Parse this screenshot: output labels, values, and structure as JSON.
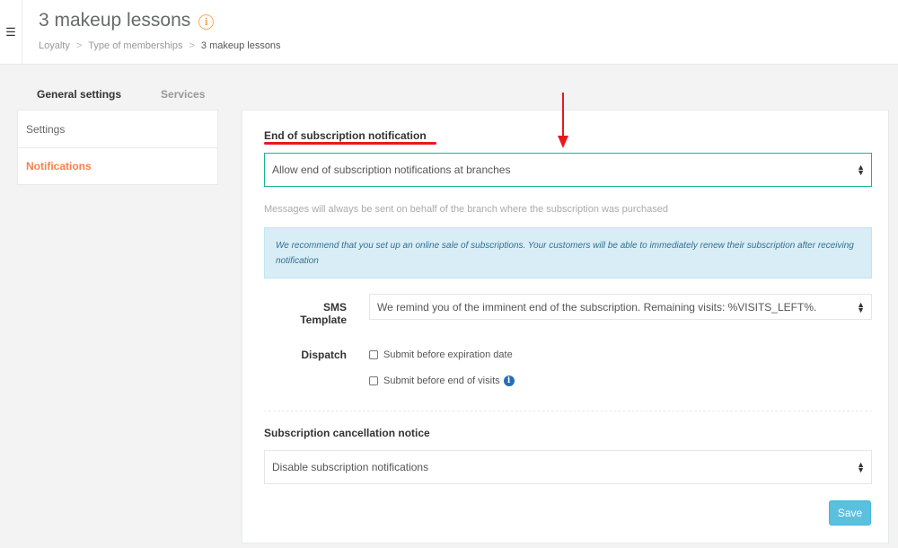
{
  "header": {
    "title": "3 makeup lessons",
    "breadcrumb": [
      "Loyalty",
      "Type of memberships",
      "3 makeup lessons"
    ],
    "separator": ">"
  },
  "tabs": [
    {
      "label": "General settings",
      "active": true
    },
    {
      "label": "Services",
      "active": false
    }
  ],
  "sidebar": {
    "items": [
      {
        "label": "Settings",
        "active": false
      },
      {
        "label": "Notifications",
        "active": true
      }
    ]
  },
  "end_notification": {
    "title": "End of subscription notification",
    "select_value": "Allow end of subscription notifications at branches",
    "help_text": "Messages will always be sent on behalf of the branch where the subscription was purchased",
    "alert_text": "We recommend that you set up an online sale of subscriptions. Your customers will be able to immediately renew their subscription after receiving notification",
    "sms_template_label": "SMS Template",
    "sms_template_value": "We remind you of the imminent end of the subscription. Remaining visits: %VISITS_LEFT%.",
    "dispatch_label": "Dispatch",
    "dispatch_options": [
      {
        "label": "Submit before expiration date",
        "checked": false
      },
      {
        "label": "Submit before end of visits",
        "checked": false
      }
    ]
  },
  "cancellation_notice": {
    "title": "Subscription cancellation notice",
    "select_value": "Disable subscription notifications"
  },
  "save_label": "Save",
  "colors": {
    "accent_orange": "#f8814a",
    "focus_green": "#1ab394",
    "save_blue": "#5bc0de",
    "annotation_red": "#e8191d"
  },
  "icons": {
    "menu": "hamburger-icon",
    "title_info": "info-circle-icon",
    "visits_info": "info-icon",
    "select_arrows": "sort-arrows-icon"
  }
}
